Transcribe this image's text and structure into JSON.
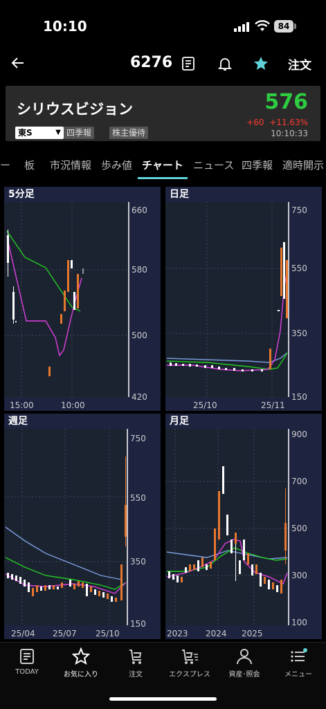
{
  "status": {
    "time": "10:10",
    "battery": "84"
  },
  "nav": {
    "code": "6276",
    "order_label": "注文"
  },
  "stock": {
    "name": "シリウスビジョン",
    "price": "576",
    "change": "+60",
    "change_pct": "+11.63%",
    "time": "10:10:33",
    "market": "東S",
    "tags": [
      "四季報",
      "株主優待"
    ]
  },
  "tabs": [
    "ー",
    "板",
    "市況情報",
    "歩み値",
    "チャート",
    "ニュース",
    "四季報",
    "適時開示"
  ],
  "active_tab": "チャート",
  "charts": [
    {
      "title": "5分足",
      "yticks": [
        "660",
        "580",
        "500",
        "420"
      ],
      "xticks": [
        "15:00",
        "10:00"
      ]
    },
    {
      "title": "日足",
      "yticks": [
        "750",
        "550",
        "350",
        "150"
      ],
      "xticks": [
        "25/10",
        "25/11"
      ]
    },
    {
      "title": "週足",
      "yticks": [
        "750",
        "550",
        "350",
        "150"
      ],
      "xticks": [
        "25/04",
        "25/07",
        "25/10"
      ]
    },
    {
      "title": "月足",
      "yticks": [
        "900",
        "700",
        "500",
        "300",
        "100"
      ],
      "xticks": [
        "2023",
        "2024",
        "2025"
      ]
    }
  ],
  "colors": {
    "up": "#e8772e",
    "down": "#ffffff",
    "ma_short": "#e040e0",
    "ma_mid": "#22cc22",
    "ma_long": "#7b9ee0",
    "accent": "#5fd3d7",
    "price_up": "#2ecc40"
  },
  "bottom_nav": [
    "TODAY",
    "お気に入り",
    "注文",
    "エクスプレス",
    "資産･照会",
    "メニュー"
  ]
}
